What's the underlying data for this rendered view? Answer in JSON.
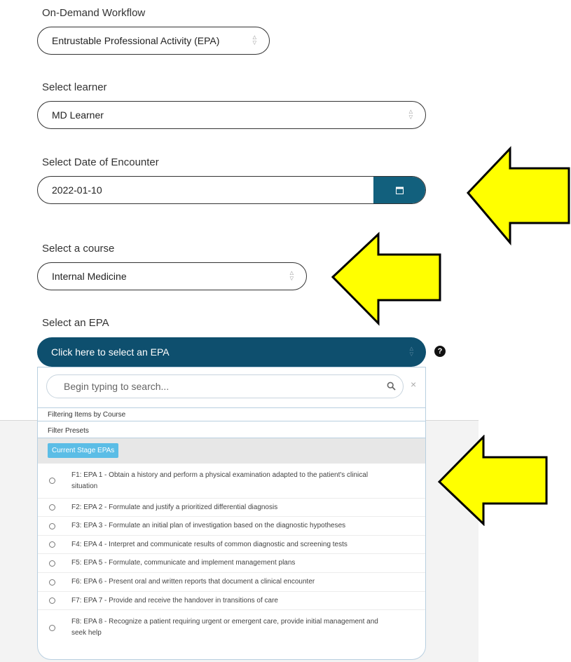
{
  "workflow": {
    "label": "On-Demand Workflow",
    "value": "Entrustable Professional Activity (EPA)"
  },
  "learner": {
    "label": "Select learner",
    "value": "MD Learner"
  },
  "encounter_date": {
    "label": "Select Date of Encounter",
    "value": "2022-01-10",
    "button_icon": "calendar-icon"
  },
  "course": {
    "label": "Select a course",
    "value": "Internal Medicine"
  },
  "epa": {
    "label": "Select an EPA",
    "placeholder": "Click here to select an EPA",
    "help_icon": "question-circle-icon",
    "search_placeholder": "Begin typing to search...",
    "filter_course": "Filtering Items by Course",
    "filter_presets": "Filter Presets",
    "preset_chip": "Current Stage EPAs",
    "items": [
      "F1: EPA 1 - Obtain a history and perform a physical examination adapted to the patient's clinical situation",
      "F2: EPA 2 - Formulate and justify a prioritized differential diagnosis",
      "F3: EPA 3 - Formulate an initial plan of investigation based on the diagnostic hypotheses",
      "F4: EPA 4 - Interpret and communicate results of common diagnostic and screening tests",
      "F5: EPA 5 - Formulate, communicate and implement management plans",
      "F6: EPA 6 - Present oral and written reports that document a clinical encounter",
      "F7: EPA 7 - Provide and receive the handover in transitions of care",
      "F8: EPA 8 - Recognize a patient requiring urgent or emergent care, provide initial management and seek help"
    ]
  },
  "colors": {
    "primary": "#0e4f6e",
    "date_button": "#12607d",
    "chip": "#5bbde6",
    "arrow_fill": "#ffff00"
  }
}
